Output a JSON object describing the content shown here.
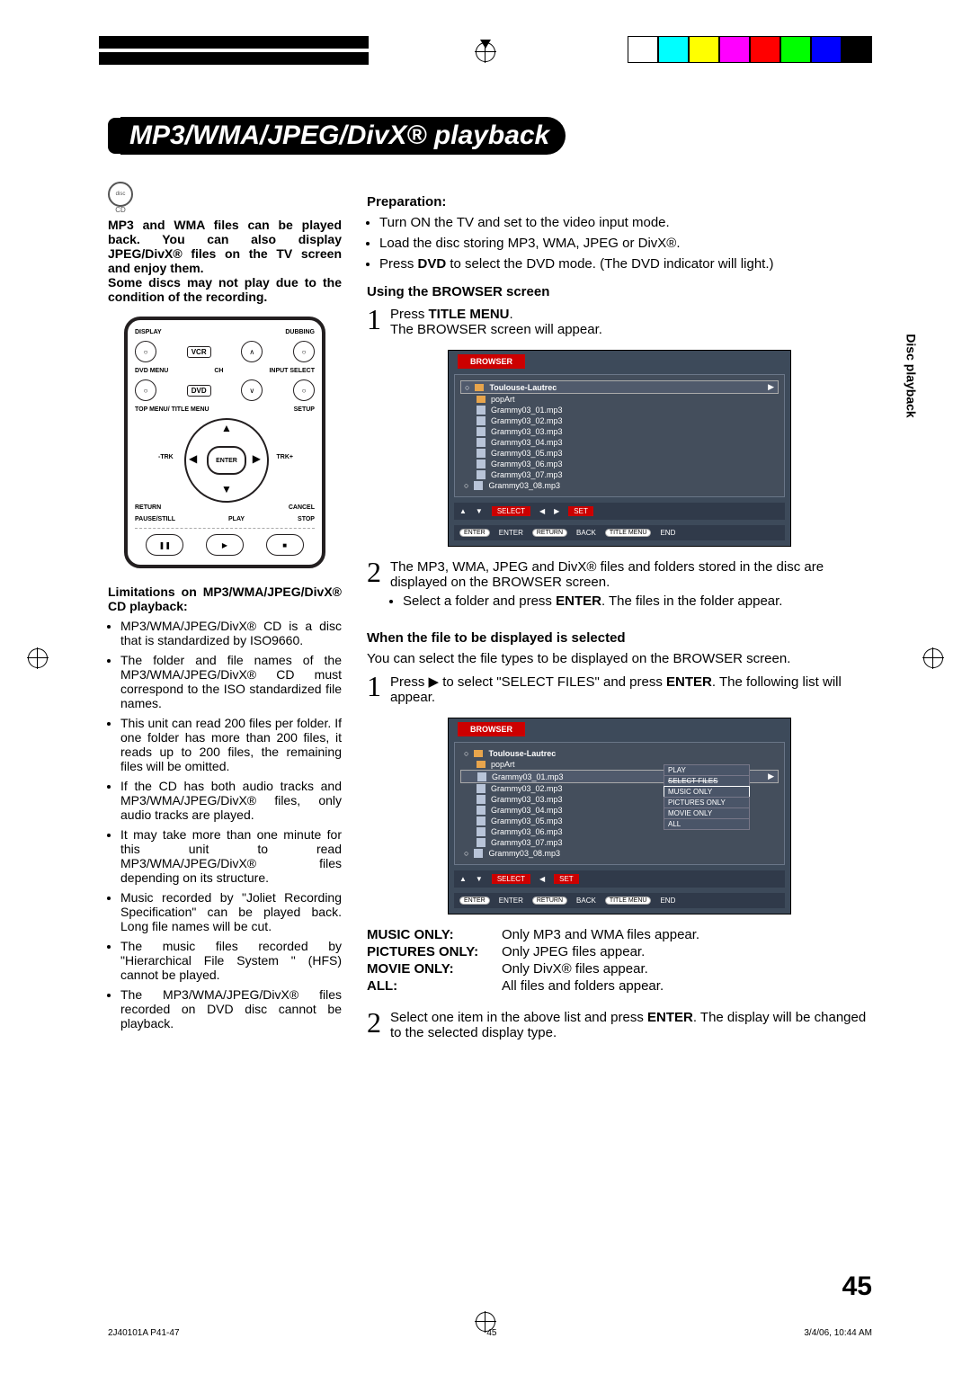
{
  "title": "MP3/WMA/JPEG/DivX® playback",
  "side_tab": "Disc playback",
  "cd_icon_label": "CD",
  "intro": "MP3 and WMA files can be played back. You can also display JPEG/DivX® files on the TV screen and enjoy them.\nSome discs may not play due to the condition of the recording.",
  "remote": {
    "labels": [
      "DISPLAY",
      "DUBBING",
      "VCR",
      "DVD MENU",
      "CH",
      "INPUT SELECT",
      "DVD",
      "TOP MENU/ TITLE MENU",
      "SETUP",
      "-TRK",
      "ENTER",
      "TRK+",
      "RETURN",
      "CANCEL",
      "PAUSE/STILL",
      "PLAY",
      "STOP"
    ]
  },
  "limitations_head": "Limitations on MP3/WMA/JPEG/DivX® CD playback:",
  "limitations": [
    "MP3/WMA/JPEG/DivX® CD is a disc that is standardized by ISO9660.",
    "The folder and file names of the MP3/WMA/JPEG/DivX® CD must correspond to the ISO standardized file names.",
    "This unit can read 200 files per folder. If one folder has more than 200 files, it reads up to 200 files, the remaining files will be omitted.",
    "If the CD has both audio tracks and MP3/WMA/JPEG/DivX® files, only audio tracks are played.",
    "It may take more than one minute for this unit to read MP3/WMA/JPEG/DivX® files depending on its structure.",
    "Music recorded by \"Joliet Recording Specification\" can be played back. Long file names will be cut.",
    "The music files recorded by \"Hierarchical File System \" (HFS) cannot be played.",
    "The MP3/WMA/JPEG/DivX® files recorded on DVD disc cannot be playback."
  ],
  "prep_head": "Preparation",
  "prep": [
    "Turn ON the TV and set to the video input mode.",
    "Load the disc storing MP3, WMA, JPEG or DivX®.",
    "Press DVD to select the DVD mode. (The DVD indicator will light.)"
  ],
  "browser_head": "Using the BROWSER screen",
  "step1_title": "Press TITLE MENU.",
  "step1_body": "The BROWSER screen will appear.",
  "browser_ui": {
    "tab": "BROWSER",
    "folder_top": "Toulouse-Lautrec",
    "subfolder": "popArt",
    "files": [
      "Grammy03_01.mp3",
      "Grammy03_02.mp3",
      "Grammy03_03.mp3",
      "Grammy03_04.mp3",
      "Grammy03_05.mp3",
      "Grammy03_06.mp3",
      "Grammy03_07.mp3",
      "Grammy03_08.mp3"
    ],
    "hints": [
      "SELECT",
      "SET",
      "ENTER",
      "ENTER",
      "RETURN",
      "BACK",
      "TITLE MENU",
      "END"
    ]
  },
  "step2a": "The MP3, WMA, JPEG and DivX® files and folders stored in the disc are displayed on the BROWSER screen.",
  "step2a_bullet": "Select a folder and press ENTER. The files in the folder appear.",
  "when_head": "When the file to be displayed is selected",
  "when_intro": "You can select the file types to be displayed on the BROWSER screen.",
  "step1b": "Press ▶ to select \"SELECT FILES\" and press ENTER. The following list will appear.",
  "submenu": [
    "PLAY",
    "SELECT FILES",
    "MUSIC ONLY",
    "PICTURES ONLY",
    "MOVIE ONLY",
    "ALL"
  ],
  "defs": [
    {
      "k": "MUSIC ONLY:",
      "v": "Only MP3 and WMA files appear."
    },
    {
      "k": "PICTURES ONLY:",
      "v": "Only JPEG files appear."
    },
    {
      "k": "MOVIE ONLY:",
      "v": "Only DivX® files appear."
    },
    {
      "k": "ALL:",
      "v": "All files and folders appear."
    }
  ],
  "step2b": "Select one item in the above list and press ENTER. The display will be changed to the selected display type.",
  "page_num": "45",
  "footer_left": "2J40101A P41-47",
  "footer_mid": "45",
  "footer_right": "3/4/06, 10:44 AM"
}
